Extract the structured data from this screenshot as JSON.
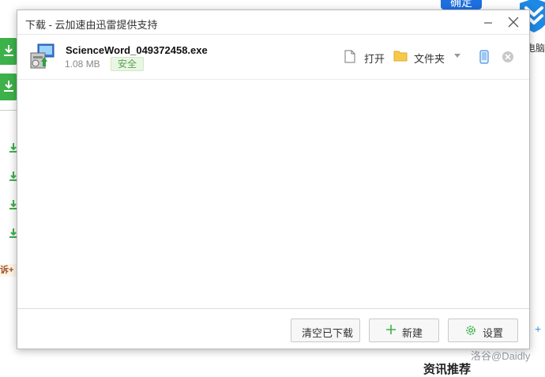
{
  "background": {
    "top_button_label": "确定",
    "right_label": "电脑",
    "left_tag": "诉+",
    "watermark": "洛谷@Daidly",
    "bottom_heading": "资讯推荐"
  },
  "dialog": {
    "title": "下载 - 云加速由迅雷提供支持",
    "download": {
      "file_name": "ScienceWord_049372458.exe",
      "file_size": "1.08 MB",
      "safety_badge": "安全",
      "open_label": "打开",
      "folder_label": "文件夹"
    },
    "footer": {
      "clear_label": "清空已下载",
      "new_label": "新建",
      "settings_label": "设置"
    }
  },
  "colors": {
    "accent_green": "#3db14a",
    "brand_blue": "#1e6fe0",
    "folder_yellow": "#f7c948",
    "safe_badge_bg": "#e9f6e3"
  },
  "icons": {
    "file": "installer-exe-icon",
    "open": "document-icon",
    "folder": "folder-icon",
    "send_to_phone": "phone-icon",
    "remove": "close-circle-icon",
    "new": "plus-icon",
    "settings": "gear-icon"
  }
}
